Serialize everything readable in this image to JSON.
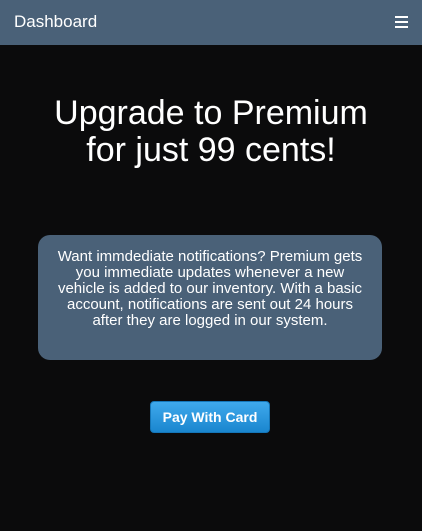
{
  "navbar": {
    "title": "Dashboard",
    "menu_icon": "hamburger-menu-icon",
    "background_color": "#4a6178"
  },
  "headline": {
    "line1": "Upgrade to Premium",
    "line2": "for just 99 cents!"
  },
  "info_card": {
    "text": "Want immdediate notifications? Premium gets you immediate updates whenever a new vehicle is added to our inventory. With a basic account, notifications are sent out 24 hours after they are logged in our system.",
    "background_color": "#4a6178"
  },
  "actions": {
    "pay_label": "Pay With Card",
    "pay_color": "#2196e0"
  },
  "page": {
    "background_color": "#0b0b0c"
  }
}
